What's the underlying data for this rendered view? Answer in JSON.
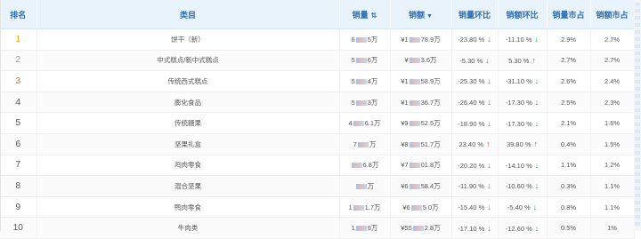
{
  "columns": {
    "rank": "排名",
    "category": "类目",
    "sales_volume": "销量",
    "sales_amount": "销额",
    "volume_mom": "销量环比",
    "amount_mom": "销额环比",
    "volume_share": "销量市占",
    "amount_share": "销额市占"
  },
  "rows": [
    {
      "rank": "1",
      "category": "饼干（新）",
      "volume_a": "6",
      "volume_b": "5万",
      "amount_a": "¥1",
      "amount_b": "78.9万",
      "vol_mom": "-23.80 %",
      "vol_dir": "down",
      "amt_mom": "-11.10 %",
      "amt_dir": "down",
      "vol_share": "2.9%",
      "amt_share": "2.7%"
    },
    {
      "rank": "2",
      "category": "中式糕点/新中式糕点",
      "volume_a": "5",
      "volume_b": "6万",
      "amount_a": "¥",
      "amount_b": "3.6万",
      "vol_mom": "-5.30 %",
      "vol_dir": "down",
      "amt_mom": "5.30 %",
      "amt_dir": "up",
      "vol_share": "2.7%",
      "amt_share": "2.7%"
    },
    {
      "rank": "3",
      "category": "传统西式糕点",
      "volume_a": "5",
      "volume_b": "4万",
      "amount_a": "¥1",
      "amount_b": "58.9万",
      "vol_mom": "-25.30 %",
      "vol_dir": "down",
      "amt_mom": "-31.10 %",
      "amt_dir": "down",
      "vol_share": "2.6%",
      "amt_share": "2.4%"
    },
    {
      "rank": "4",
      "category": "膨化食品",
      "volume_a": "5",
      "volume_b": "3万",
      "amount_a": "¥1",
      "amount_b": "36.7万",
      "vol_mom": "-26.40 %",
      "vol_dir": "down",
      "amt_mom": "-17.30 %",
      "amt_dir": "down",
      "vol_share": "2.5%",
      "amt_share": "2.3%"
    },
    {
      "rank": "5",
      "category": "传统糖果",
      "volume_a": "4",
      "volume_b": "6.1万",
      "amount_a": "¥9",
      "amount_b": "52.5万",
      "vol_mom": "-18.90 %",
      "vol_dir": "down",
      "amt_mom": "-17.30 %",
      "amt_dir": "down",
      "vol_share": "2.1%",
      "amt_share": "1.6%"
    },
    {
      "rank": "6",
      "category": "坚果礼盒",
      "volume_a": "7",
      "volume_b": "万",
      "amount_a": "¥8",
      "amount_b": "51.7万",
      "vol_mom": "23.40 %",
      "vol_dir": "up",
      "amt_mom": "39.80 %",
      "amt_dir": "up",
      "vol_share": "0.4%",
      "amt_share": "1.5%"
    },
    {
      "rank": "7",
      "category": "鸡肉零食",
      "volume_a": "",
      "volume_b": "6.8万",
      "amount_a": "¥7",
      "amount_b": "01.8万",
      "vol_mom": "-20.20 %",
      "vol_dir": "down",
      "amt_mom": "-14.10 %",
      "amt_dir": "down",
      "vol_share": "1.1%",
      "amt_share": "1.2%"
    },
    {
      "rank": "8",
      "category": "混合坚果",
      "volume_a": "",
      "volume_b": "万",
      "amount_a": "¥6",
      "amount_b": "58.4万",
      "vol_mom": "-11.90 %",
      "vol_dir": "down",
      "amt_mom": "-10.60 %",
      "amt_dir": "down",
      "vol_share": "0.3%",
      "amt_share": "1.1%"
    },
    {
      "rank": "9",
      "category": "鸭肉零食",
      "volume_a": "1",
      "volume_b": "1.7万",
      "amount_a": "¥6",
      "amount_b": "5.0万",
      "vol_mom": "-15.40 %",
      "vol_dir": "down",
      "amt_mom": "-5.40 %",
      "amt_dir": "down",
      "vol_share": "0.8%",
      "amt_share": "1.1%"
    },
    {
      "rank": "10",
      "category": "牛肉类",
      "volume_a": "1",
      "volume_b": "9万",
      "amount_a": "¥55",
      "amount_b": "2.8万",
      "vol_mom": "-17.10 %",
      "vol_dir": "down",
      "amt_mom": "-12.60 %",
      "amt_dir": "down",
      "vol_share": "0.5%",
      "amt_share": "1%"
    }
  ],
  "icons": {
    "up": "arrow-up-icon",
    "down": "arrow-down-icon",
    "sort": "sort-icon"
  },
  "colors": {
    "header_bg": "#e9f3fb",
    "header_text": "#2f6db3",
    "up": "#e04b4b",
    "down": "#3aa544",
    "rank1": "#f2a20c",
    "rank3": "#c0773a"
  }
}
